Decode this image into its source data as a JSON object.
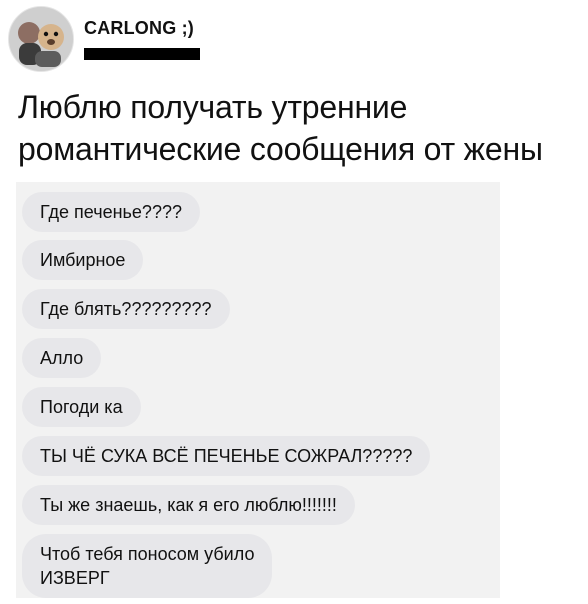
{
  "post": {
    "author": {
      "name": "CARLONG ;)",
      "avatar_icon": "profile-avatar-icon"
    },
    "caption": "Люблю получать утренние романтические сообщения от жены"
  },
  "chat": {
    "messages": [
      {
        "text": "Где печенье????"
      },
      {
        "text": "Имбирное"
      },
      {
        "text": "Где блять?????????"
      },
      {
        "text": "Алло"
      },
      {
        "text": "Погоди ка"
      },
      {
        "text": "ТЫ ЧЁ СУКА ВСЁ ПЕЧЕНЬЕ СОЖРАЛ?????"
      },
      {
        "text": "Ты же знаешь, как я его люблю!!!!!!!"
      },
      {
        "text": "Чтоб тебя поносом убило\nИЗВЕРГ"
      }
    ]
  },
  "colors": {
    "bubble": "#e7e7ea",
    "chat_background": "#f2f2f2",
    "redaction": "#000000"
  }
}
